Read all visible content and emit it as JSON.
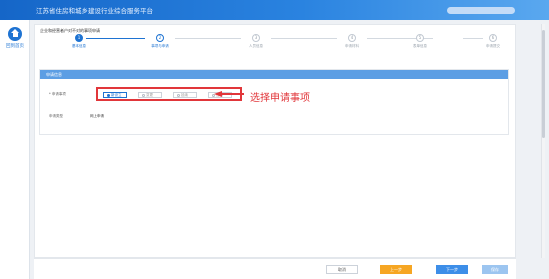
{
  "app": {
    "title": "江苏省住房和城乡建设行业综合服务平台",
    "blurred_user": ""
  },
  "sidebar": {
    "home_label": "回到首页",
    "home_icon": "home-icon"
  },
  "panel": {
    "title": "企业和经营者户对不对的事项申请"
  },
  "steps": [
    {
      "num": "1",
      "label": "基本信息",
      "state": "active"
    },
    {
      "num": "2",
      "label": "事项与申请",
      "state": "current"
    },
    {
      "num": "3",
      "label": "人员信息",
      "state": "todo"
    },
    {
      "num": "4",
      "label": "申请材料",
      "state": "todo"
    },
    {
      "num": "5",
      "label": "表单信息",
      "state": "todo"
    },
    {
      "num": "6",
      "label": "申请提交",
      "state": "todo"
    }
  ],
  "section": {
    "header": "申请信息",
    "apply_item_label": "* 申请事项",
    "options": [
      "新设立",
      "变更",
      "延续",
      "注销"
    ],
    "selected_option": "新设立",
    "type_label": "申请类型",
    "type_value": "网上申请"
  },
  "annotation": {
    "text": "选择申请事项",
    "color": "#e1363a"
  },
  "footer": {
    "cancel": "取消",
    "prev": "上一步",
    "next": "下一步",
    "save": "保存"
  },
  "colors": {
    "primary": "#1e73d2",
    "accent_orange": "#f6a623",
    "highlight_red": "#e1363a"
  }
}
